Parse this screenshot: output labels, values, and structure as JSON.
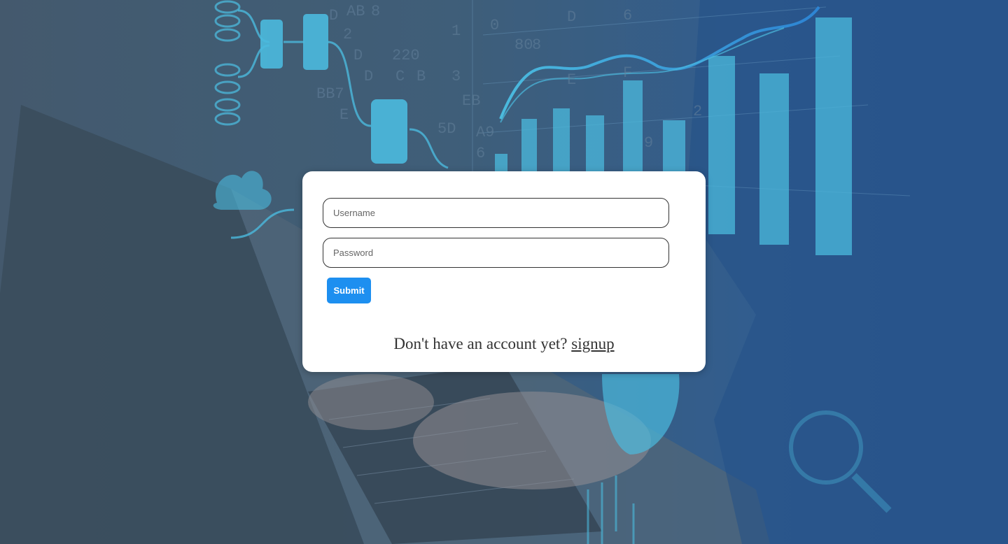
{
  "login": {
    "username_placeholder": "Username",
    "password_placeholder": "Password",
    "submit_label": "Submit",
    "signup_prompt": "Don't have an account yet?",
    "signup_link": "signup"
  },
  "colors": {
    "submit_bg": "#1d8ff0",
    "card_bg": "#ffffff",
    "backdrop_tint": "#3e5a72",
    "accent_cyan": "#4fd0f5"
  },
  "background": {
    "hex_glyphs": [
      "1",
      "D",
      "AB",
      "8",
      "2",
      "0",
      "D",
      "6",
      "220",
      "3",
      "D",
      "C",
      "B",
      "5D",
      "A9",
      "6",
      "8",
      "D",
      "E",
      "F",
      "9",
      "2",
      "8",
      "BB7",
      "E",
      "80",
      "EB"
    ]
  }
}
